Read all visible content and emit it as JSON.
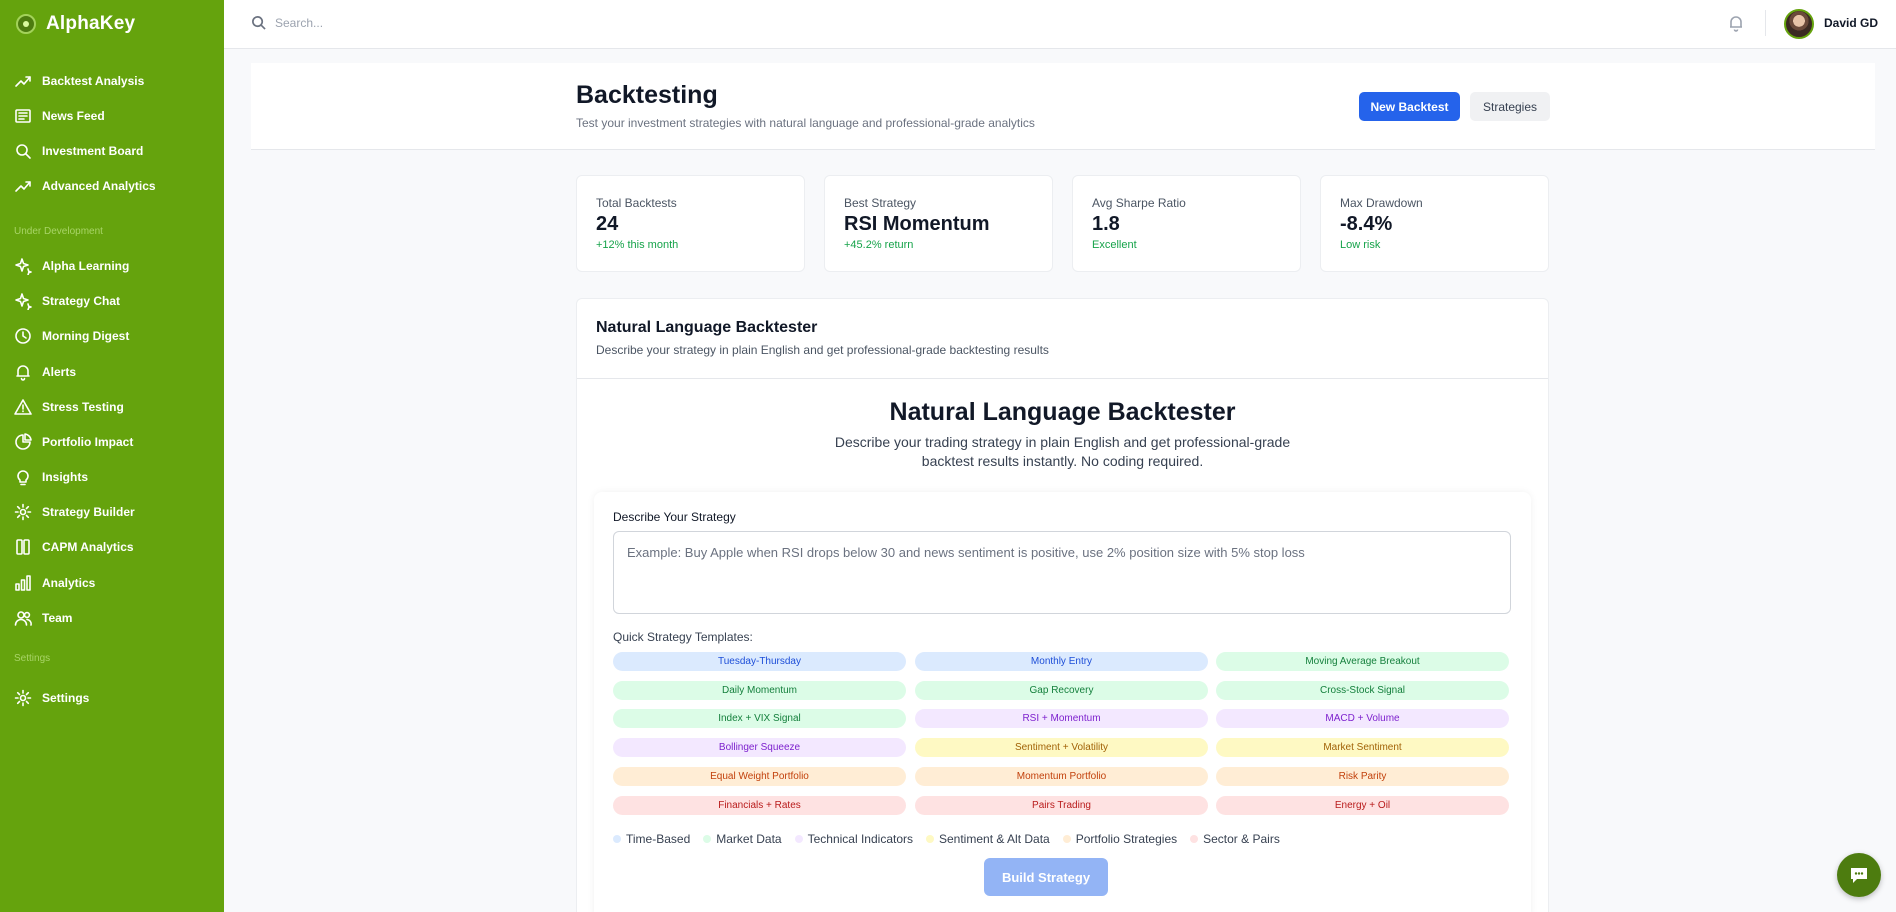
{
  "app": {
    "name": "AlphaKey"
  },
  "sidebar": {
    "items": [
      {
        "label": "Backtest Analysis",
        "icon": "trending-up-icon"
      },
      {
        "label": "News Feed",
        "icon": "newspaper-icon"
      },
      {
        "label": "Investment Board",
        "icon": "search-icon"
      },
      {
        "label": "Advanced Analytics",
        "icon": "trending-up-icon"
      }
    ],
    "section_dev": "Under Development",
    "dev_items": [
      {
        "label": "Alpha Learning",
        "icon": "sparkles-icon"
      },
      {
        "label": "Strategy Chat",
        "icon": "sparkles-icon"
      },
      {
        "label": "Morning Digest",
        "icon": "clock-icon"
      },
      {
        "label": "Alerts",
        "icon": "bell-icon"
      },
      {
        "label": "Stress Testing",
        "icon": "warning-icon"
      },
      {
        "label": "Portfolio Impact",
        "icon": "pie-chart-icon"
      },
      {
        "label": "Insights",
        "icon": "lightbulb-icon"
      },
      {
        "label": "Strategy Builder",
        "icon": "gear-icon"
      },
      {
        "label": "CAPM Analytics",
        "icon": "columns-icon"
      },
      {
        "label": "Analytics",
        "icon": "bar-chart-icon"
      },
      {
        "label": "Team",
        "icon": "users-icon"
      }
    ],
    "section_settings": "Settings",
    "settings_items": [
      {
        "label": "Settings",
        "icon": "gear-icon"
      }
    ]
  },
  "topbar": {
    "search_placeholder": "Search...",
    "user_name": "David GD"
  },
  "header": {
    "title": "Backtesting",
    "subtitle": "Test your investment strategies with natural language and professional-grade analytics",
    "new_backtest_label": "New Backtest",
    "strategies_label": "Strategies"
  },
  "stats": [
    {
      "label": "Total Backtests",
      "value": "24",
      "sub": "+12% this month"
    },
    {
      "label": "Best Strategy",
      "value": "RSI Momentum",
      "sub": "+45.2% return"
    },
    {
      "label": "Avg Sharpe Ratio",
      "value": "1.8",
      "sub": "Excellent"
    },
    {
      "label": "Max Drawdown",
      "value": "-8.4%",
      "sub": "Low risk"
    }
  ],
  "nlb_card": {
    "title": "Natural Language Backtester",
    "subtitle": "Describe your strategy in plain English and get professional-grade backtesting results",
    "main_title": "Natural Language Backtester",
    "description": "Describe your trading strategy in plain English and get professional-grade backtest results instantly. No coding required.",
    "describe_label": "Describe Your Strategy",
    "input_value": "",
    "input_placeholder": "Example: Buy Apple when RSI drops below 30 and news sentiment is positive, use 2% position size with 5% stop loss",
    "templates_label": "Quick Strategy Templates:",
    "build_label": "Build Strategy"
  },
  "templates": [
    {
      "label": "Tuesday-Thursday",
      "category": "time"
    },
    {
      "label": "Monthly Entry",
      "category": "time"
    },
    {
      "label": "Moving Average Breakout",
      "category": "market"
    },
    {
      "label": "Daily Momentum",
      "category": "market"
    },
    {
      "label": "Gap Recovery",
      "category": "market"
    },
    {
      "label": "Cross-Stock Signal",
      "category": "market"
    },
    {
      "label": "Index + VIX Signal",
      "category": "market"
    },
    {
      "label": "RSI + Momentum",
      "category": "tech"
    },
    {
      "label": "MACD + Volume",
      "category": "tech"
    },
    {
      "label": "Bollinger Squeeze",
      "category": "tech"
    },
    {
      "label": "Sentiment + Volatility",
      "category": "sentiment"
    },
    {
      "label": "Market Sentiment",
      "category": "sentiment"
    },
    {
      "label": "Equal Weight Portfolio",
      "category": "portfolio"
    },
    {
      "label": "Momentum Portfolio",
      "category": "portfolio"
    },
    {
      "label": "Risk Parity",
      "category": "portfolio"
    },
    {
      "label": "Financials + Rates",
      "category": "sector"
    },
    {
      "label": "Pairs Trading",
      "category": "sector"
    },
    {
      "label": "Energy + Oil",
      "category": "sector"
    }
  ],
  "legend": [
    {
      "label": "Time-Based",
      "category": "time"
    },
    {
      "label": "Market Data",
      "category": "market"
    },
    {
      "label": "Technical Indicators",
      "category": "tech"
    },
    {
      "label": "Sentiment & Alt Data",
      "category": "sentiment"
    },
    {
      "label": "Portfolio Strategies",
      "category": "portfolio"
    },
    {
      "label": "Sector & Pairs",
      "category": "sector"
    }
  ],
  "category_colors": {
    "time": {
      "bg": "#dbeafe",
      "fg": "#1d4ed8"
    },
    "market": {
      "bg": "#dcfce7",
      "fg": "#15803d"
    },
    "tech": {
      "bg": "#f3e8ff",
      "fg": "#7e22ce"
    },
    "sentiment": {
      "bg": "#fef9c3",
      "fg": "#a16207"
    },
    "portfolio": {
      "bg": "#ffedd5",
      "fg": "#c2410c"
    },
    "sector": {
      "bg": "#fee2e2",
      "fg": "#b91c1c"
    }
  },
  "colors": {
    "sidebar": "#65a30d",
    "primary": "#2563eb",
    "positive": "#16a34a"
  }
}
